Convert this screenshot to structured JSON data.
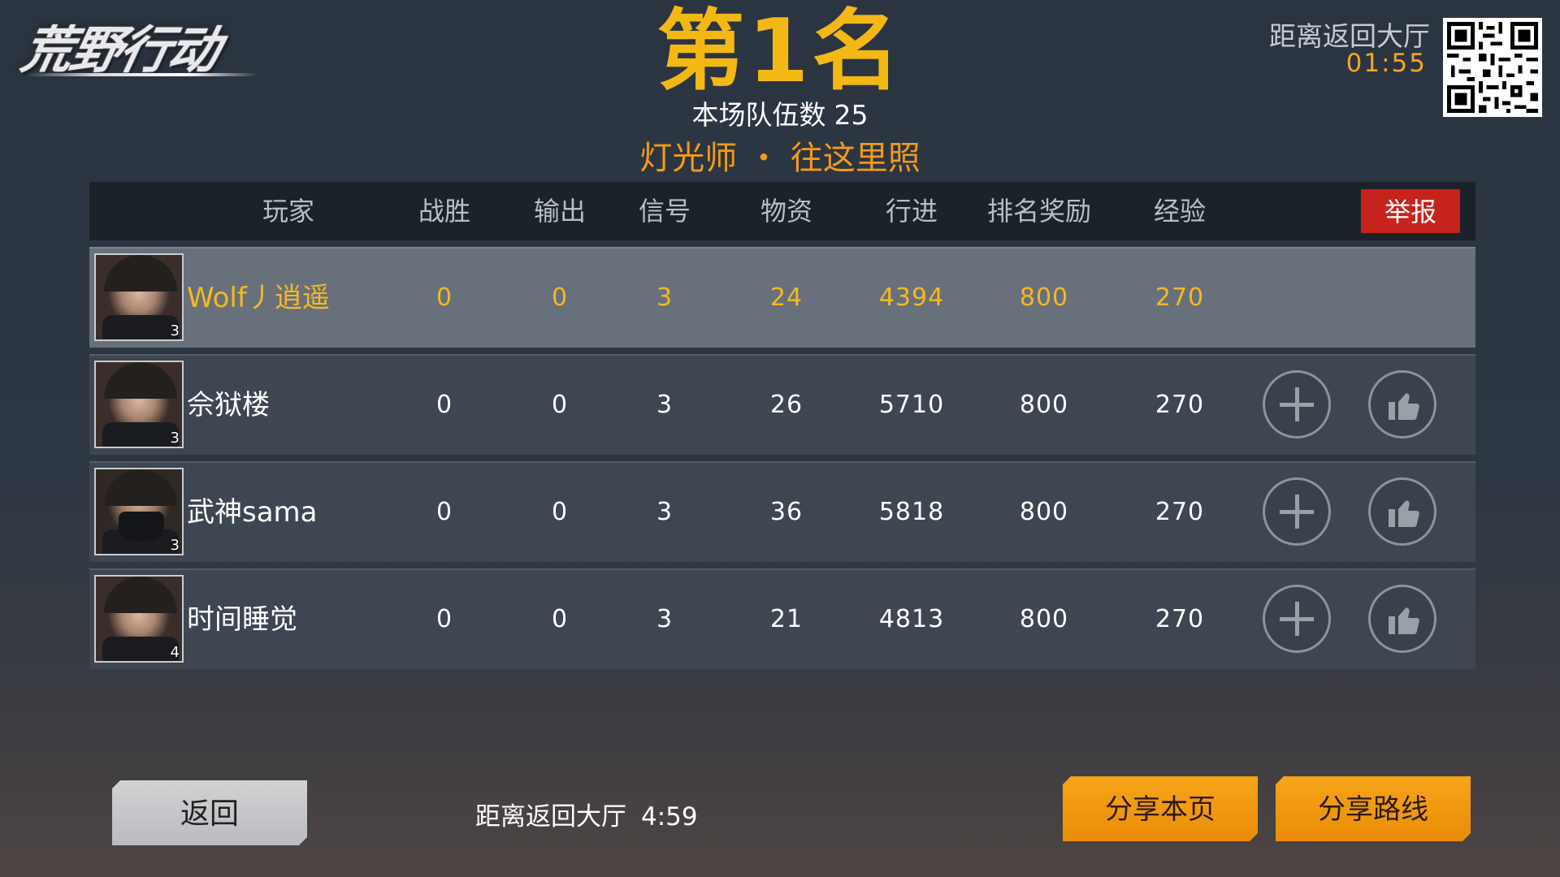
{
  "game": {
    "logo_text": "荒野行动"
  },
  "header": {
    "rank_title": "第1名",
    "team_count_label": "本场队伍数",
    "team_count": "25",
    "honor_title": "灯光师 ・ 往这里照",
    "return_label": "距离返回大厅",
    "return_timer": "01:55"
  },
  "table": {
    "columns": [
      "玩家",
      "战胜",
      "输出",
      "信号",
      "物资",
      "行进",
      "排名奖励",
      "经验"
    ],
    "report_label": "举报",
    "rows": [
      {
        "name": "Wolf丿逍遥",
        "level": "3",
        "kills": "0",
        "damage": "0",
        "signal": "3",
        "supplies": "24",
        "travel": "4394",
        "rank_reward": "800",
        "exp": "270",
        "is_self": true,
        "avatar": "female-headset-avatar"
      },
      {
        "name": "佘狱楼",
        "level": "3",
        "kills": "0",
        "damage": "0",
        "signal": "3",
        "supplies": "26",
        "travel": "5710",
        "rank_reward": "800",
        "exp": "270",
        "is_self": false,
        "avatar": "female-headset-avatar"
      },
      {
        "name": "武神sama",
        "level": "3",
        "kills": "0",
        "damage": "0",
        "signal": "3",
        "supplies": "36",
        "travel": "5818",
        "rank_reward": "800",
        "exp": "270",
        "is_self": false,
        "avatar": "masked-male-avatar"
      },
      {
        "name": "时间睡觉",
        "level": "4",
        "kills": "0",
        "damage": "0",
        "signal": "3",
        "supplies": "21",
        "travel": "4813",
        "rank_reward": "800",
        "exp": "270",
        "is_self": false,
        "avatar": "female-headset-avatar"
      }
    ]
  },
  "footer": {
    "back_label": "返回",
    "countdown_label": "距离返回大厅",
    "countdown_time": "4:59",
    "share_page_label": "分享本页",
    "share_route_label": "分享路线"
  },
  "colors": {
    "gold": "#f4b814",
    "orange": "#f39a18",
    "report_red": "#c7231d",
    "share_orange": "#ea8c06"
  },
  "icons": {
    "add_friend": "plus-icon",
    "like": "thumbs-up-icon",
    "qr": "qr-code-icon"
  }
}
